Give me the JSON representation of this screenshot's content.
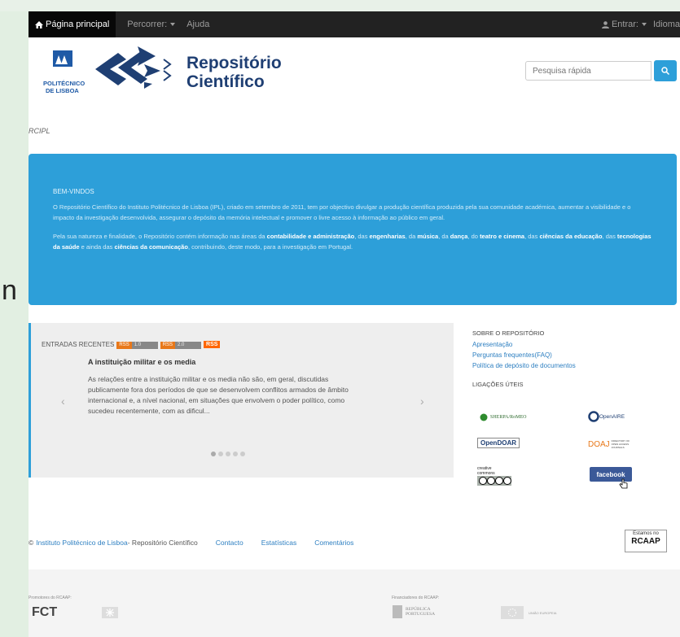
{
  "nav": {
    "home": "Página principal",
    "browse": "Percorrer:",
    "help": "Ajuda",
    "login": "Entrar:",
    "language": "Idioma"
  },
  "header": {
    "institution_line1": "POLITÉCNICO",
    "institution_line2": "DE LISBOA",
    "repo_title_line1": "Repositório",
    "repo_title_line2": "Científico",
    "search_placeholder": "Pesquisa rápida"
  },
  "breadcrumb": "RCIPL",
  "side_letter": "n",
  "welcome": {
    "heading": "BEM-VINDOS",
    "para1": "O Repositório Científico do Instituto Politécnico de Lisboa (IPL), criado em setembro de 2011, tem por objectivo divulgar a produção científica produzida pela sua comunidade académica, aumentar a visibilidade e o impacto da investigação desenvolvida, assegurar o depósito da memória intelectual e promover o livre acesso à informação ao público em geral.",
    "para2_start": "Pela sua natureza e finalidade, o Repositório contém informação nas áreas da ",
    "area1": "contabilidade e administração",
    "sep1": ", das ",
    "area2": "engenharias",
    "sep2": ", da ",
    "area3": "música",
    "sep3": ", da ",
    "area4": "dança",
    "sep4": ", do ",
    "area5": "teatro e cinema",
    "sep5": ", das ",
    "area6": "ciências da educação",
    "sep6": ", das ",
    "area7": "tecnologias da saúde",
    "sep7": " e ainda das ",
    "area8": "ciências da comunicação",
    "para2_end": ", contribuindo, deste modo, para a investigação em Portugal."
  },
  "recent": {
    "heading": "ENTRADAS RECENTES",
    "rss1": "RSS",
    "rss1_ver": "1.0",
    "rss2": "RSS",
    "rss2_ver": "2.0",
    "rss3": "RSS",
    "item_title": "A instituição militar e os media",
    "item_text": "As relações entre a instituição militar e os media não são, em geral, discutidas publicamente fora dos períodos de que se desenvolvem conflitos armados de âmbito internacional e, a nível nacional, em situações que envolvem o poder político, como sucedeu recentemente, com as dificul...",
    "prev": "‹",
    "next": "›"
  },
  "sidebar": {
    "about_heading": "SOBRE O REPOSITÓRIO",
    "links": [
      "Apresentação",
      "Perguntas frequentes(FAQ)",
      "Política de depósito de documentos"
    ],
    "useful_heading": "LIGAÇÕES ÚTEIS",
    "sherpa": "SHERPA/RoMEO",
    "openaire": "OpenAIRE",
    "opendoar": "OpenDOAR",
    "doaj": "DOAJ",
    "doaj_sub": "DIRECTORY OF OPEN ACCESS JOURNALS",
    "cc": "creative commons",
    "facebook": "facebook"
  },
  "footer": {
    "copyright": "©",
    "institution": "Instituto Politécnico de Lisboa",
    "suffix": " - Repositório Científico",
    "contact": "Contacto",
    "stats": "Estatísticas",
    "comments": "Comentários",
    "rcaap_top": "Estamos no",
    "rcaap": "RCAAP"
  },
  "sponsors": {
    "promoters_label": "Promotores do RCAAP:",
    "funders_label": "Financiadores do RCAAP:",
    "fct": "FCT",
    "republica": "REPÚBLICA PORTUGUESA",
    "ue": "UNIÃO EUROPEIA"
  },
  "colors": {
    "accent": "#2d9fd9",
    "navbar": "#222222",
    "title": "#1f3f73"
  }
}
